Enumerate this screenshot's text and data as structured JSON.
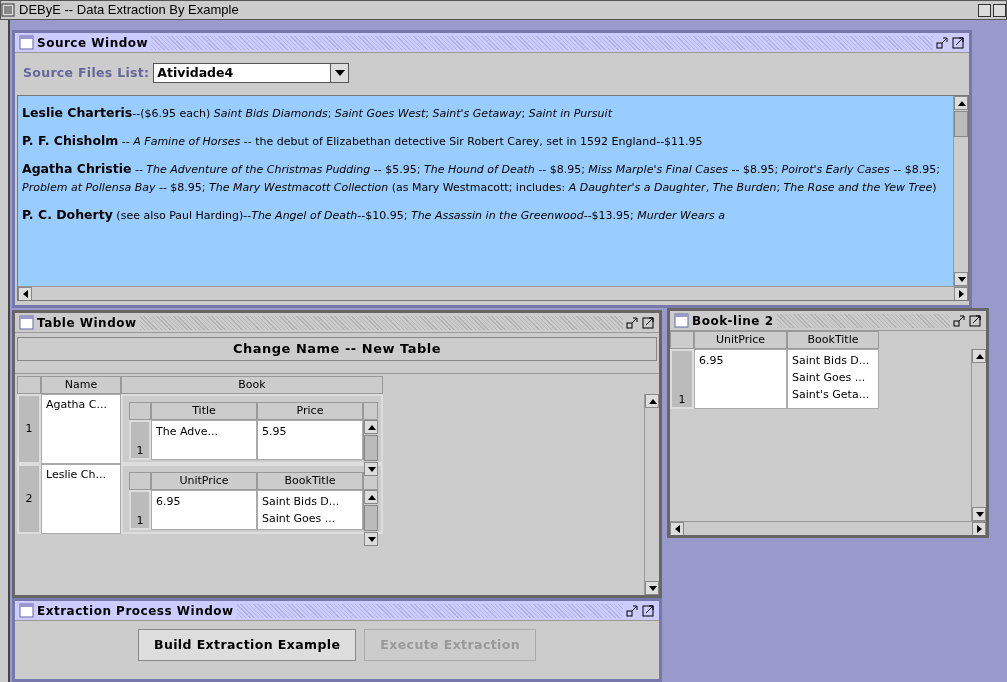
{
  "window": {
    "title": "DEByE -- Data Extraction By Example"
  },
  "source_window": {
    "title": "Source Window",
    "active": true,
    "files_label": "Source Files List:",
    "file": "Atividade4",
    "paragraphs": [
      "**Leslie Charteris**--($6.95 each) *Saint Bids Diamonds*; *Saint Goes West*; *Saint's Getaway*; *Saint in Pursuit*",
      "**P. F. Chisholm** -- *A Famine of Horses* -- the debut of Elizabethan detective Sir Robert Carey, set in 1592 England--$11.95",
      "**Agatha Christie** -- *The Adventure of the Christmas Pudding* -- $5.95; *The Hound of Death* -- $8.95; *Miss Marple's Final Cases* -- $8.95; *Poirot's Early Cases* -- $8.95; *Problem at Pollensa Bay* -- $8.95; *The Mary Westmacott Collection* (as Mary Westmacott; includes: *A Daughter's a Daughter*, *The Burden*; *The Rose and the Yew Tree*)",
      "**P. C. Doherty** (see also Paul Harding)--*The Angel of Death*--$10.95; *The Assassin in the Greenwood*--$13.95; *Murder Wears a*"
    ]
  },
  "table_window": {
    "title": "Table Window",
    "active": false,
    "table_name": "Change Name -- New Table",
    "columns": [
      "Name",
      "Book"
    ],
    "rows": [
      {
        "index": "1",
        "name": "Agatha C...",
        "book": {
          "columns": [
            "Title",
            "Price"
          ],
          "rows": [
            {
              "index": "1",
              "cells": [
                [
                  "The Adve..."
                ],
                [
                  "5.95"
                ]
              ]
            }
          ]
        }
      },
      {
        "index": "2",
        "name": "Leslie Ch...",
        "book": {
          "columns": [
            "UnitPrice",
            "BookTitle"
          ],
          "rows": [
            {
              "index": "1",
              "cells": [
                [
                  "6.95"
                ],
                [
                  "Saint Bids D...",
                  "Saint Goes ..."
                ]
              ]
            }
          ]
        }
      }
    ]
  },
  "book_window": {
    "title": "Book-line 2",
    "active": false,
    "columns": [
      "UnitPrice",
      "BookTitle"
    ],
    "rows": [
      {
        "index": "1",
        "cells": [
          [
            "6.95"
          ],
          [
            "Saint Bids D...",
            "Saint Goes ...",
            "Saint's Geta..."
          ]
        ]
      }
    ]
  },
  "extraction_window": {
    "title": "Extraction Process Window",
    "active": true,
    "buttons": [
      {
        "label": "Build Extraction Example",
        "disabled": false
      },
      {
        "label": "Execute Extraction",
        "disabled": true
      }
    ]
  }
}
